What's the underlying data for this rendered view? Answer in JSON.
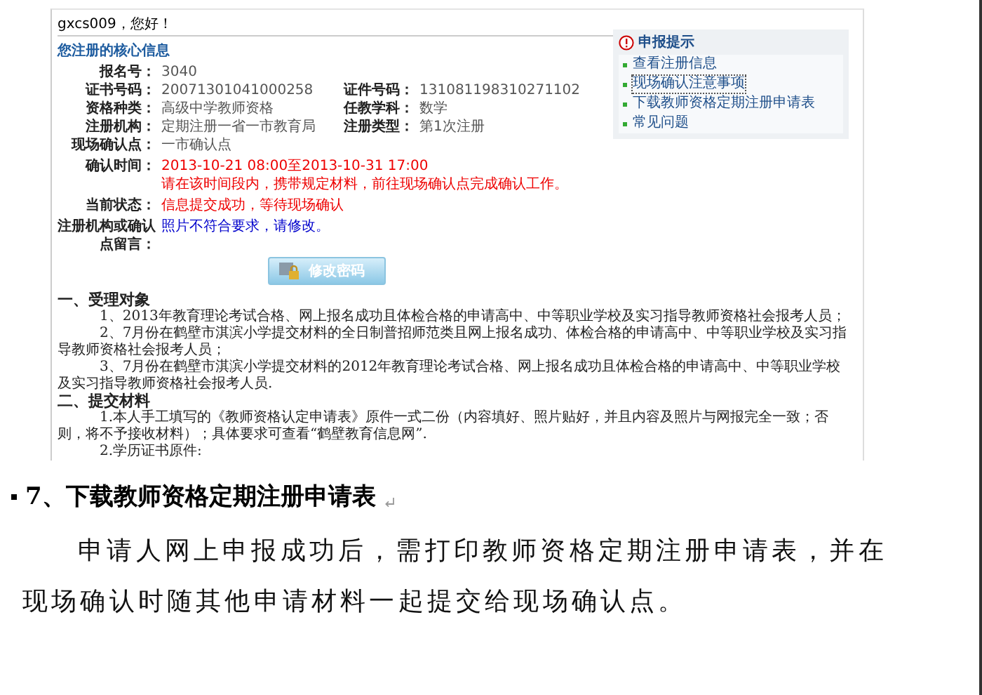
{
  "screenshot": {
    "greeting": "gxcs009，您好！",
    "heading": "您注册的核心信息",
    "rows": [
      [
        {
          "label": "报名号：",
          "value": "3040"
        }
      ],
      [
        {
          "label": "证书号码：",
          "value": "20071301041000258"
        },
        {
          "label": "证件号码：",
          "value": "131081198310271102"
        }
      ],
      [
        {
          "label": "资格种类：",
          "value": "高级中学教师资格"
        },
        {
          "label": "任教学科：",
          "value": "数学"
        }
      ],
      [
        {
          "label": "注册机构：",
          "value": "定期注册一省一市教育局"
        },
        {
          "label": "注册类型：",
          "value": "第1次注册"
        }
      ],
      [
        {
          "label": "现场确认点：",
          "value": "一市确认点"
        }
      ]
    ],
    "details": [
      {
        "kind": "alert",
        "label": "确认时间：",
        "lines": [
          "2013-10-21 08:00至2013-10-31 17:00",
          "请在该时间段内，携带规定材料，前往现场确认点完成确认工作。"
        ]
      },
      {
        "kind": "alert",
        "label": "当前状态：",
        "lines": [
          "信息提交成功，等待现场确认"
        ]
      },
      {
        "kind": "note",
        "label": "注册机构或确认点留言：",
        "lines": [
          "照片不符合要求，请修改。"
        ]
      }
    ],
    "button": "修改密码",
    "tips": {
      "title": "申报提示",
      "links": [
        {
          "label": "查看注册信息",
          "selected": false
        },
        {
          "label": "现场确认注意事项",
          "selected": true
        },
        {
          "label": "下载教师资格定期注册申请表",
          "selected": false
        },
        {
          "label": "常见问题",
          "selected": false
        }
      ]
    }
  },
  "document": {
    "sections": [
      {
        "title": "一、受理对象",
        "paragraphs": [
          "1、2013年教育理论考试合格、网上报名成功且体检合格的申请高中、中等职业学校及实习指导教师资格社会报考人员；",
          "2、7月份在鹤壁市淇滨小学提交材料的全日制普招师范类且网上报名成功、体检合格的申请高中、中等职业学校及实习指导教师资格社会报考人员；",
          "3、7月份在鹤壁市淇滨小学提交材料的2012年教育理论考试合格、网上报名成功且体检合格的申请高中、中等职业学校及实习指导教师资格社会报考人员."
        ]
      },
      {
        "title": "二、提交材料",
        "paragraphs": [
          "1.本人手工填写的《教师资格认定申请表》原件一式二份（内容填好、照片贴好，并且内容及照片与网报完全一致；否则，将不予接收材料）；具体要求可查看“鹤壁教育信息网”.",
          "2.学历证书原件:"
        ]
      }
    ],
    "heading": "7、下载教师资格定期注册申请表",
    "body": "申请人网上申报成功后，需打印教师资格定期注册申请表，并在现场确认时随其他申请材料一起提交给现场确认点。"
  }
}
